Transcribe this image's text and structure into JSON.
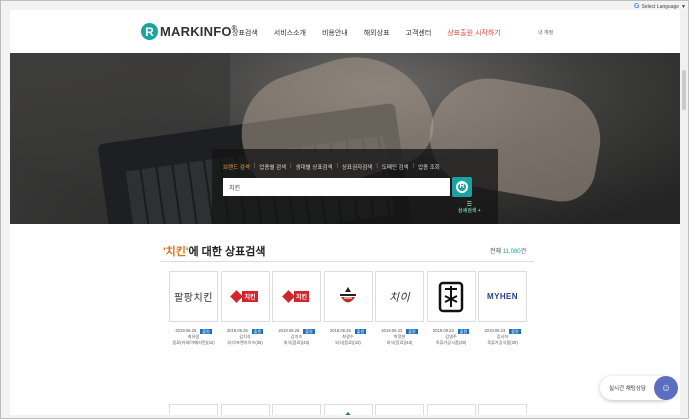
{
  "header": {
    "logo_mark": "R",
    "logo_text": "MARKINFO",
    "logo_reg": "®",
    "nav": [
      "상표검색",
      "서비스소개",
      "비용안내",
      "해외상표",
      "고객센터",
      "상표출원 시작하기"
    ],
    "account": "내 계정",
    "language_label": "Select Language",
    "language_arrow": "▼"
  },
  "search": {
    "tabs": [
      "브랜드 검색",
      "업종별 검색",
      "생대별 상표검색",
      "상표권자검색",
      "도메인 검색",
      "업종 조회"
    ],
    "active_tab_index": 0,
    "query": "치킨",
    "advanced_label": "상세검색 +"
  },
  "results": {
    "keyword": "'치킨'",
    "title_suffix": "에 대한 상표검색",
    "count_prefix": "전체",
    "count_value": "11,080",
    "count_suffix": "건",
    "items": [
      {
        "thumb_text": "팔팡치킨",
        "date": "2019.09.26",
        "badge": "출원",
        "owner": "최유림",
        "category": "음료(커피/아메리칸)(42)"
      },
      {
        "thumb_text": "치킨",
        "date": "2019.09.26",
        "badge": "출원",
        "owner": "김치숙",
        "category": "외식/프랜차이즈(35)"
      },
      {
        "thumb_text": "치킨",
        "date": "2019.09.26",
        "badge": "출원",
        "owner": "김치숙",
        "category": "외식(음료)(43)"
      },
      {
        "thumb_text": "",
        "date": "2019.09.26",
        "badge": "출원",
        "owner": "최광수",
        "category": "외식(음료)(43)"
      },
      {
        "thumb_text": "치이",
        "date": "2019.09.23",
        "badge": "출원",
        "owner": "박정현",
        "category": "외식(음료)(43)"
      },
      {
        "thumb_text": "",
        "date": "2019.09.23",
        "badge": "출원",
        "owner": "김영주",
        "category": "육류가공식품(29)"
      },
      {
        "thumb_text": "MYHEN",
        "date": "2019.09.23",
        "badge": "출원",
        "owner": "김시하",
        "category": "육류가공식품(29)"
      }
    ]
  },
  "chat": {
    "label": "실시간 채팅상담",
    "icon": "chat-bot-icon"
  }
}
